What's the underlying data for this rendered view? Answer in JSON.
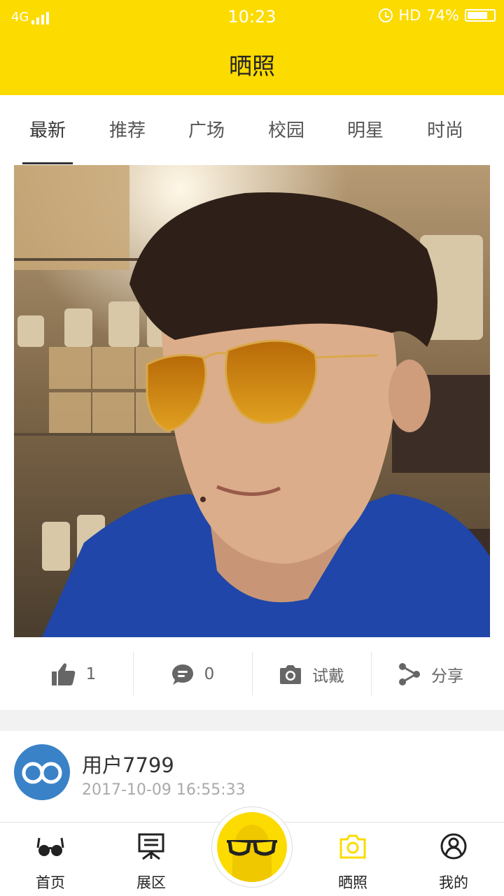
{
  "status_bar": {
    "network": "4G",
    "time": "10:23",
    "hd": "HD",
    "battery": "74%"
  },
  "header": {
    "title": "晒照"
  },
  "tabs": [
    {
      "label": "最新",
      "active": true
    },
    {
      "label": "推荐"
    },
    {
      "label": "广场"
    },
    {
      "label": "校园"
    },
    {
      "label": "明星"
    },
    {
      "label": "时尚"
    }
  ],
  "post": {
    "image_alt": "selfie-with-virtual-sunglasses",
    "likes": "1",
    "comments": "0",
    "try_on_label": "试戴",
    "share_label": "分享"
  },
  "next_post": {
    "username": "用户7799",
    "timestamp": "2017-10-09 16:55:33"
  },
  "bottom_nav": [
    {
      "label": "首页",
      "icon": "glasses-icon"
    },
    {
      "label": "展区",
      "icon": "exhibit-icon"
    },
    {
      "label": "",
      "icon": "glasses-face-icon"
    },
    {
      "label": "晒照",
      "icon": "camera-icon",
      "active": true
    },
    {
      "label": "我的",
      "icon": "user-icon"
    }
  ],
  "colors": {
    "accent": "#FCDB00",
    "avatar": "#3A82C8",
    "active_icon": "#FCDB00"
  }
}
